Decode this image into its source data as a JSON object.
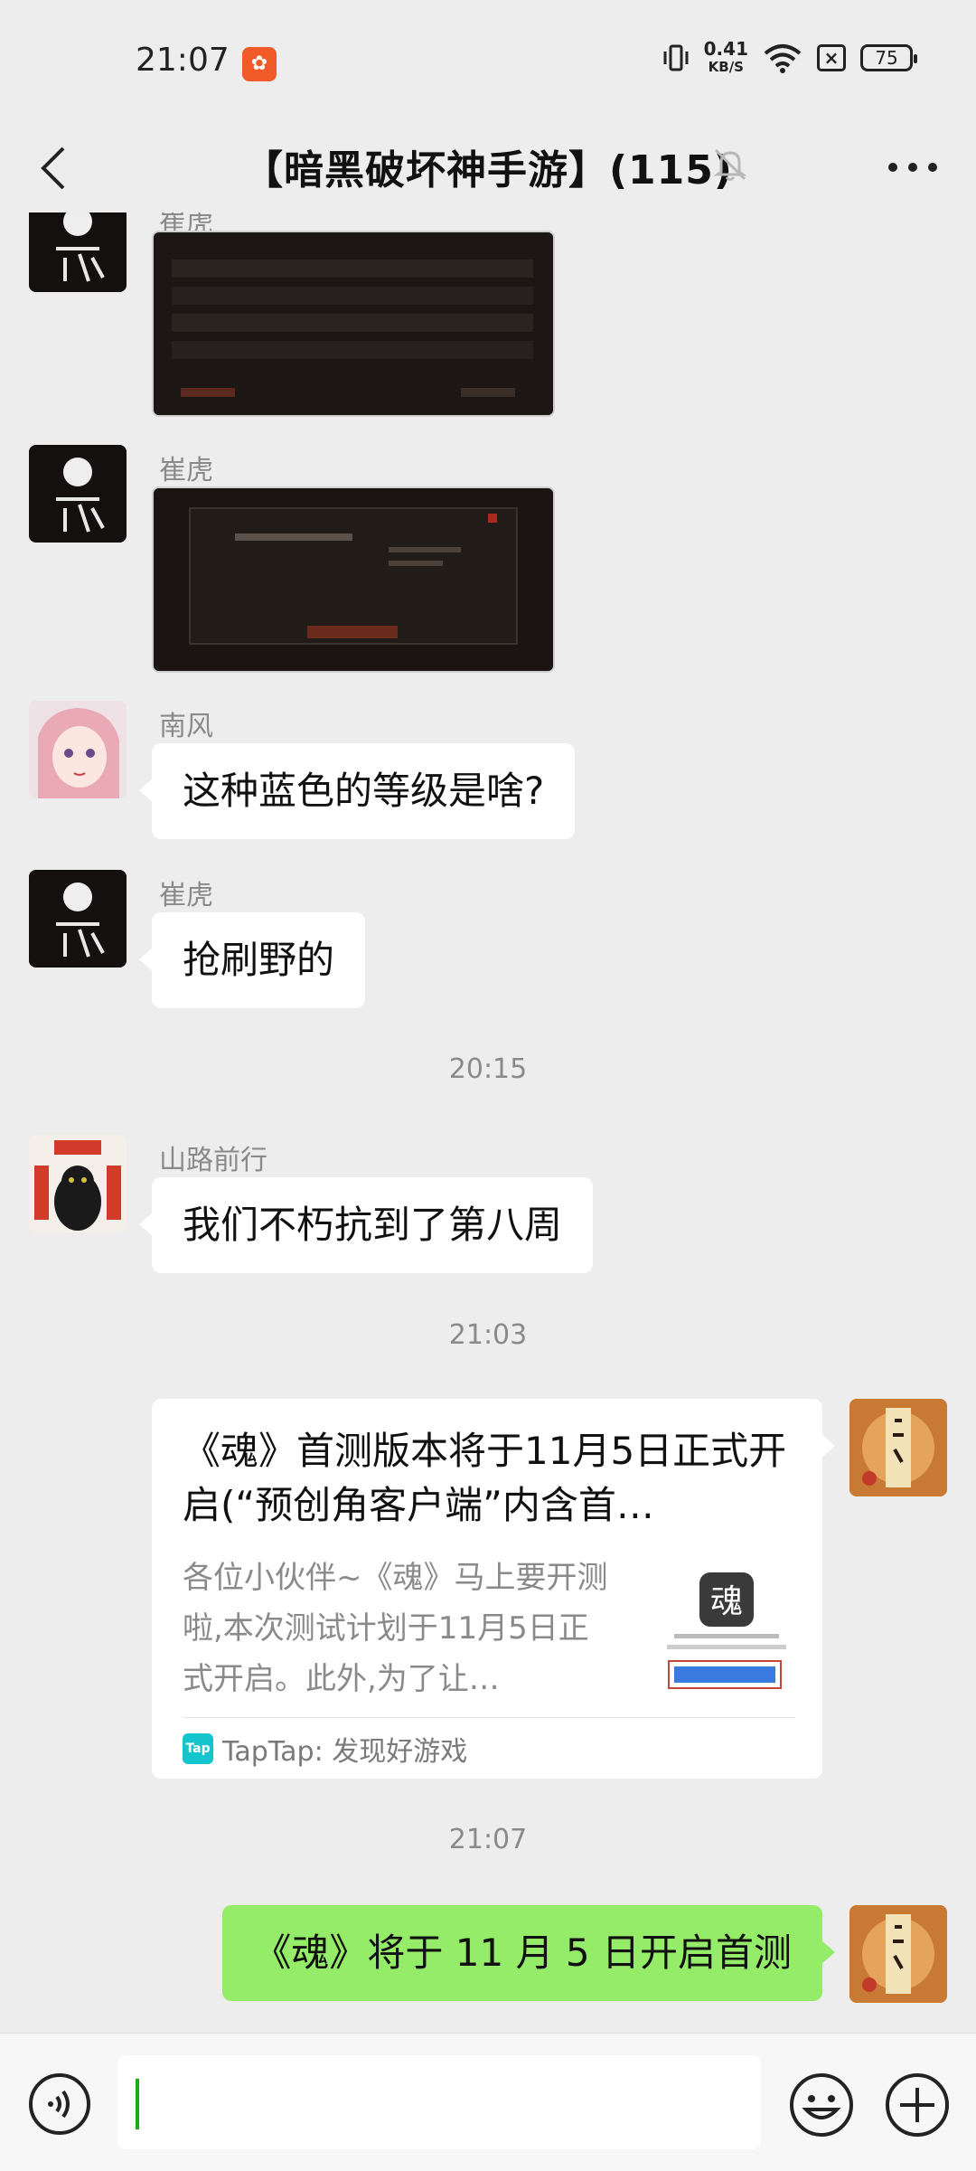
{
  "status_bar": {
    "time": "21:07",
    "speed_value": "0.41",
    "speed_unit": "KB/S",
    "battery": "75"
  },
  "header": {
    "title": "【暗黑破坏神手游】(115)"
  },
  "messages": {
    "m1_name": "崔虎",
    "m2_name": "崔虎",
    "m3_name": "南风",
    "m3_text": "这种蓝色的等级是啥?",
    "m4_name": "崔虎",
    "m4_text": "抢刷野的",
    "ts1": "20:15",
    "m5_name": "山路前行",
    "m5_text": "我们不朽抗到了第八周",
    "ts2": "21:03",
    "card": {
      "title": "《魂》首测版本将于11月5日正式开启(“预创角客户端”内含首…",
      "description": "各位小伙伴~《魂》马上要开测啦,本次测试计划于11月5日正式开启。此外,为了让…",
      "source": "TapTap: 发现好游戏",
      "source_logo": "Tap"
    },
    "ts3": "21:07",
    "m7_text": "《魂》将于 11 月 5 日开启首测"
  },
  "colors": {
    "background": "#ededed",
    "my_bubble": "#95ec69",
    "other_bubble": "#ffffff"
  },
  "icons": [
    "back-icon",
    "mute-bell-icon",
    "more-icon",
    "voice-icon",
    "emoji-icon",
    "plus-icon"
  ]
}
